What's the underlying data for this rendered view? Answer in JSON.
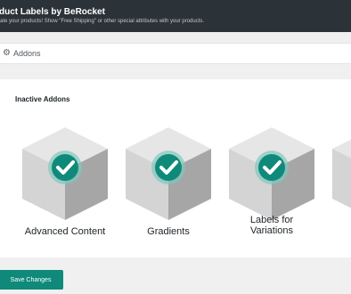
{
  "header": {
    "title": "duct Labels by BeRocket",
    "description": "ate your products! Show \"Free Shipping\" or other special attributes with your products."
  },
  "tabs": {
    "active": {
      "label": "Addons",
      "icon": "gear-icon"
    }
  },
  "section": {
    "title": "Inactive Addons",
    "addons": [
      {
        "name": "Advanced Content"
      },
      {
        "name": "Gradients"
      },
      {
        "name": "Labels for",
        "name2": "Variations"
      }
    ]
  },
  "footer": {
    "save_label": "Save Changes"
  },
  "colors": {
    "accent": "#0f8a7a",
    "header_bg": "#2c3338",
    "cube_top": "#e6e6e6",
    "cube_left": "#d4d4d4",
    "cube_right": "#a6a6a6"
  }
}
